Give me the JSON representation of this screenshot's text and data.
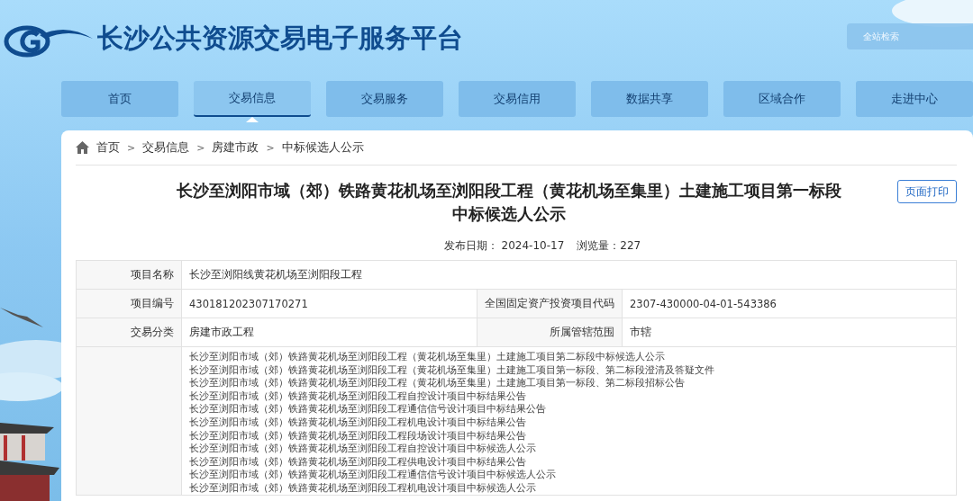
{
  "header": {
    "site_title": "长沙公共资源交易电子服务平台",
    "search": {
      "placeholder": "全站检索"
    }
  },
  "nav": [
    {
      "label": "首页",
      "selected": false
    },
    {
      "label": "交易信息",
      "selected": true
    },
    {
      "label": "交易服务",
      "selected": false
    },
    {
      "label": "交易信用",
      "selected": false
    },
    {
      "label": "数据共享",
      "selected": false
    },
    {
      "label": "区域合作",
      "selected": false
    },
    {
      "label": "走进中心",
      "selected": false
    }
  ],
  "breadcrumb": [
    "首页",
    "交易信息",
    "房建市政",
    "中标候选人公示"
  ],
  "breadcrumb_separator": ">",
  "article": {
    "title": "长沙至浏阳市域（郊）铁路黄花机场至浏阳段工程（黄花机场至集里）土建施工项目第一标段中标候选人公示",
    "print_button": "页面打印",
    "publish_date_label": "发布日期：",
    "publish_date": "2024-10-17",
    "views_label": "浏览量：",
    "views": "227"
  },
  "info_table": {
    "rows": [
      [
        {
          "label": "项目名称",
          "value": "长沙至浏阳线黄花机场至浏阳段工程"
        }
      ],
      [
        {
          "label": "项目编号",
          "value": "430181202307170271"
        },
        {
          "label": "全国固定资产投资项目代码",
          "value": "2307-430000-04-01-543386"
        }
      ],
      [
        {
          "label": "交易分类",
          "value": "房建市政工程"
        },
        {
          "label": "所属管辖范围",
          "value": "市辖"
        }
      ]
    ],
    "related_links": [
      "长沙至浏阳市域（郊）铁路黄花机场至浏阳段工程（黄花机场至集里）土建施工项目第二标段中标候选人公示",
      "长沙至浏阳市域（郊）铁路黄花机场至浏阳段工程（黄花机场至集里）土建施工项目第一标段、第二标段澄清及答疑文件",
      "长沙至浏阳市域（郊）铁路黄花机场至浏阳段工程（黄花机场至集里）土建施工项目第一标段、第二标段招标公告",
      "长沙至浏阳市域（郊）铁路黄花机场至浏阳段工程自控设计项目中标结果公告",
      "长沙至浏阳市域（郊）铁路黄花机场至浏阳段工程通信信号设计项目中标结果公告",
      "长沙至浏阳市域（郊）铁路黄花机场至浏阳段工程机电设计项目中标结果公告",
      "长沙至浏阳市域（郊）铁路黄花机场至浏阳段工程段场设计项目中标结果公告",
      "长沙至浏阳市域（郊）铁路黄花机场至浏阳段工程自控设计项目中标候选人公示",
      "长沙至浏阳市域（郊）铁路黄花机场至浏阳段工程供电设计项目中标结果公告",
      "长沙至浏阳市域（郊）铁路黄花机场至浏阳段工程通信信号设计项目中标候选人公示",
      "长沙至浏阳市域（郊）铁路黄花机场至浏阳段工程机电设计项目中标候选人公示"
    ]
  }
}
